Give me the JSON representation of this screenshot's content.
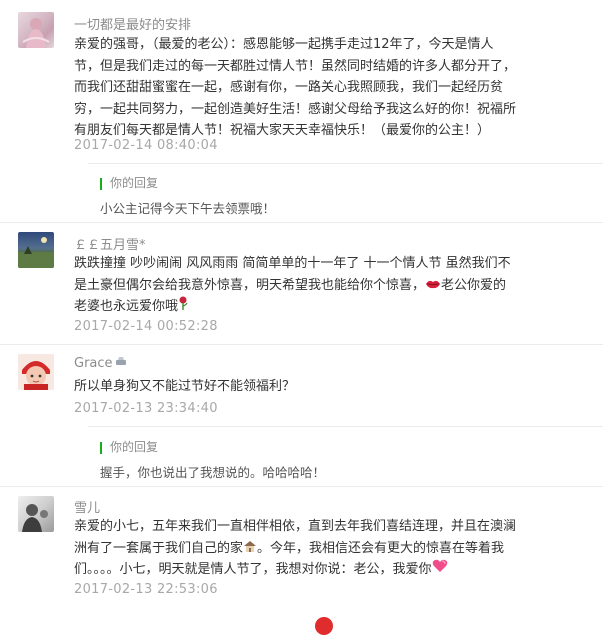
{
  "comments": [
    {
      "nickname": "一切都是最好的安排",
      "lines": [
        "亲爱的强哥，（最爱的老公）：感恩能够一起携手走过12年了，今天是情人",
        "节，但是我们走过的每一天都胜过情人节！虽然同时结婚的许多人都分开了，",
        "而我们还甜甜蜜蜜在一起，感谢有你，一路关心我照顾我，我们一起经历贫",
        "穷，一起共同努力，一起创造美好生活！感谢父母给予我这么好的你！祝福所",
        "有朋友们每天都是情人节！祝福大家天天幸福快乐！（最爱你的公主！）"
      ],
      "timestamp": "2017-02-14 08:40:04",
      "reply": {
        "label": "你的回复",
        "text": "小公主记得今天下午去领票哦！"
      }
    },
    {
      "nickname": "￡￡五月雪*",
      "lines": [
        "跌跌撞撞 吵吵闹闹 风风雨雨 简简单单的十一年了 十一个情人节 虽然我们不",
        "是土豪但偶尔会给我意外惊喜，明天希望我也能给你个惊喜，",
        "老婆也永远爱你哦"
      ],
      "line2_suffix": "老公你爱的",
      "timestamp": "2017-02-14 00:52:28"
    },
    {
      "nickname": "Grace",
      "lines": [
        "所以单身狗又不能过节好不能领福利？"
      ],
      "timestamp": "2017-02-13 23:34:40",
      "reply": {
        "label": "你的回复",
        "text": "握手，你也说出了我想说的。哈哈哈哈！"
      }
    },
    {
      "nickname": "雪儿",
      "lines": [
        "亲爱的小七，五年来我们一直相伴相依，直到去年我们喜结连理，并且在澳澜",
        "洲有了一套属于我们自己的家",
        "们。。。。小七，明天就是情人节了，我想对你说：老公，我爱你"
      ],
      "line2_suffix": "。今年，我相信还会有更大的惊喜在等着我",
      "timestamp": "2017-02-13 22:53:06"
    }
  ],
  "icons": {
    "lips": "lips-emoji-icon",
    "rose": "rose-emoji-icon",
    "house": "house-emoji-icon",
    "heart": "heart-emoji-icon",
    "medal": "medal-icon"
  },
  "colors": {
    "reply_bar": "#1aad19",
    "timestamp": "#a8a8a8",
    "nickname": "#8c8c8c"
  }
}
